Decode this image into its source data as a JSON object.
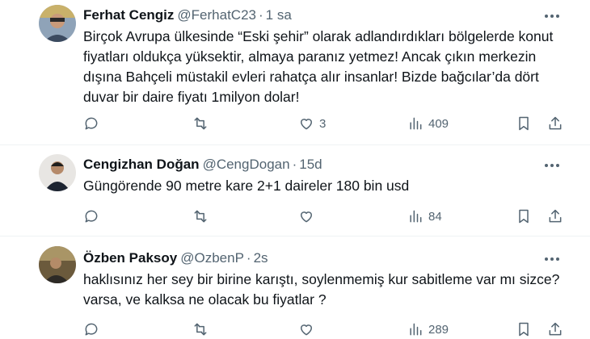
{
  "tweets": [
    {
      "name": "Ferhat Cengiz",
      "handle": "@FerhatC23",
      "separator": "·",
      "time": "1 sa",
      "text": "Birçok Avrupa ülkesinde “Eski şehir” olarak adlandırdıkları bölgelerde konut fiyatları oldukça yüksektir, almaya paranız yetmez! Ancak çıkın merkezin dışına Bahçeli müstakil evleri rahatça alır insanlar! Bizde bağcılar’da dört duvar bir daire fiyatı 1milyon dolar!",
      "likes": "3",
      "views": "409"
    },
    {
      "name": "Cengizhan Doğan",
      "handle": "@CengDogan",
      "separator": "·",
      "time": "15d",
      "text": "Güngörende 90 metre kare 2+1 daireler 180 bin usd",
      "likes": "",
      "views": "84"
    },
    {
      "name": "Özben Paksoy",
      "handle": "@OzbenP",
      "separator": "·",
      "time": "2s",
      "text": "haklısınız her sey bir birine karıştı, soylenmemiş kur sabitleme var mı sizce? varsa, ve kalksa ne olacak bu fiyatlar ?",
      "likes": "",
      "views": "289"
    }
  ],
  "colors": {
    "text": "#0f1419",
    "secondary": "#536471",
    "divider": "#eff3f4"
  },
  "icons": [
    "reply-icon",
    "retweet-icon",
    "like-icon",
    "views-icon",
    "bookmark-icon",
    "share-icon",
    "more-icon"
  ]
}
